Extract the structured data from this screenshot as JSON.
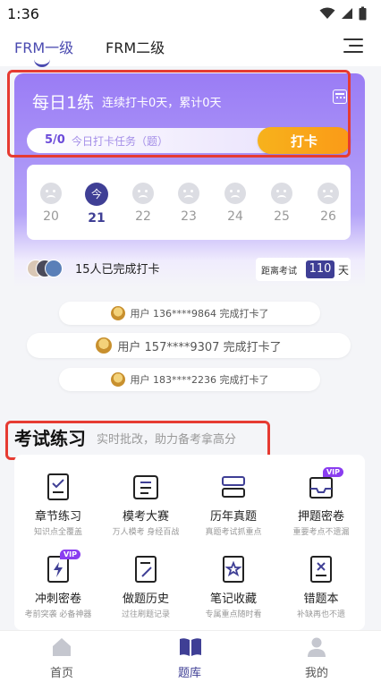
{
  "status_bar": {
    "time": "1:36"
  },
  "header": {
    "tabs": [
      {
        "label": "FRM一级",
        "active": true
      },
      {
        "label": "FRM二级",
        "active": false
      }
    ]
  },
  "checkin": {
    "title": "每日1练",
    "subtitle": "连续打卡0天，累计0天",
    "task_count": "5/0",
    "task_label": "今日打卡任务（题）",
    "button_label": "打卡",
    "days": [
      {
        "num": "20",
        "today": false
      },
      {
        "num": "21",
        "today": true,
        "badge": "今"
      },
      {
        "num": "22",
        "today": false
      },
      {
        "num": "23",
        "today": false
      },
      {
        "num": "24",
        "today": false
      },
      {
        "num": "25",
        "today": false
      },
      {
        "num": "26",
        "today": false
      }
    ],
    "completed_text": "15人已完成打卡",
    "exam_countdown": {
      "label": "距离考试",
      "days": "110",
      "unit": "天"
    },
    "feed": [
      "用户 136****9864 完成打卡了",
      "用户 157****9307 完成打卡了",
      "用户 183****2236 完成打卡了"
    ]
  },
  "practice": {
    "title": "考试练习",
    "subtitle": "实时批改，助力备考拿高分",
    "items": [
      {
        "label": "章节练习",
        "sub": "知识点全覆盖",
        "icon": "document-check-icon",
        "vip": false
      },
      {
        "label": "模考大赛",
        "sub": "万人模考 身经百战",
        "icon": "scroll-icon",
        "vip": false
      },
      {
        "label": "历年真题",
        "sub": "真题考试抓重点",
        "icon": "books-icon",
        "vip": false
      },
      {
        "label": "押题密卷",
        "sub": "重要考点不遗漏",
        "icon": "inbox-icon",
        "vip": true
      },
      {
        "label": "冲刺密卷",
        "sub": "考前突袭 必备神器",
        "icon": "lightning-doc-icon",
        "vip": true
      },
      {
        "label": "做题历史",
        "sub": "过往刷题记录",
        "icon": "edit-doc-icon",
        "vip": false
      },
      {
        "label": "笔记收藏",
        "sub": "专属重点随时看",
        "icon": "star-doc-icon",
        "vip": false
      },
      {
        "label": "错题本",
        "sub": "补缺再也不遗",
        "icon": "wrong-doc-icon",
        "vip": false
      }
    ],
    "vip_label": "VIP"
  },
  "bottom_nav": [
    {
      "label": "首页",
      "icon": "home-icon",
      "active": false
    },
    {
      "label": "题库",
      "icon": "book-icon",
      "active": true
    },
    {
      "label": "我的",
      "icon": "user-icon",
      "active": false
    }
  ],
  "colors": {
    "accent": "#3f3f95",
    "purple": "#9a7cf5",
    "orange": "#f7a81b",
    "highlight": "#e63b32"
  }
}
